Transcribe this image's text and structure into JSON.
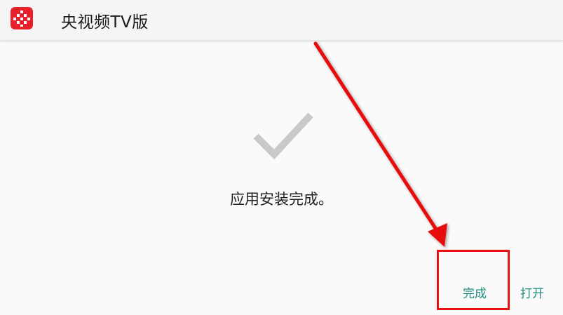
{
  "titlebar": {
    "title": "央视频TV版",
    "icon": "cctv-app-logo",
    "icon_color": "#e8202a"
  },
  "main": {
    "status_icon": "checkmark-icon",
    "message": "应用安装完成。"
  },
  "actions": {
    "done_label": "完成",
    "open_label": "打开",
    "accent_color": "#1f8f7e"
  },
  "annotation": {
    "color": "#e81010"
  }
}
